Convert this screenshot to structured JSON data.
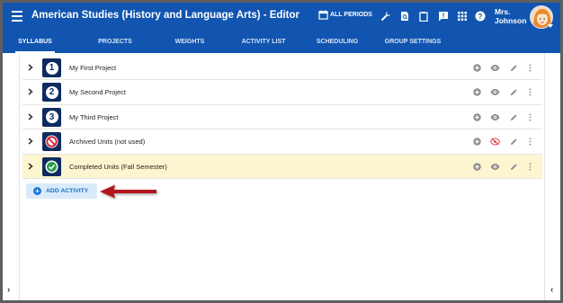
{
  "app": {
    "title": "American Studies (History and Language Arts) - Editor",
    "periods_label": "ALL PERIODS",
    "user_name_line1": "Mrs.",
    "user_name_line2": "Johnson"
  },
  "icons": [
    "menu-icon",
    "calendar-icon",
    "wrench-icon",
    "search-doc-icon",
    "clipboard-icon",
    "feedback-icon",
    "apps-grid-icon",
    "help-icon"
  ],
  "tabs": [
    {
      "label": "SYLLABUS",
      "active": true
    },
    {
      "label": "PROJECTS",
      "active": false
    },
    {
      "label": "WEIGHTS",
      "active": false
    },
    {
      "label": "ACTIVITY LIST",
      "active": false
    },
    {
      "label": "SCHEDULING",
      "active": false
    },
    {
      "label": "GROUP SETTINGS",
      "active": false
    }
  ],
  "rows": [
    {
      "badge": "1",
      "title": "My First Project",
      "hidden": false,
      "highlighted": false
    },
    {
      "badge": "2",
      "title": "My Second Project",
      "hidden": false,
      "highlighted": false
    },
    {
      "badge": "3",
      "title": "My Third Project",
      "hidden": false,
      "highlighted": false
    },
    {
      "badge": "no-entry-icon",
      "title": "Archived Units (not used)",
      "hidden": true,
      "highlighted": false
    },
    {
      "badge": "check-icon",
      "title": "Completed Units (Fall Semester)",
      "hidden": false,
      "highlighted": true
    }
  ],
  "add_button": {
    "label": "ADD ACTIVITY"
  },
  "colors": {
    "appbar": "#1155b0",
    "highlight_row": "#fdf5cf",
    "arrow": "#b3141b",
    "badge": "#0d2b5e"
  }
}
